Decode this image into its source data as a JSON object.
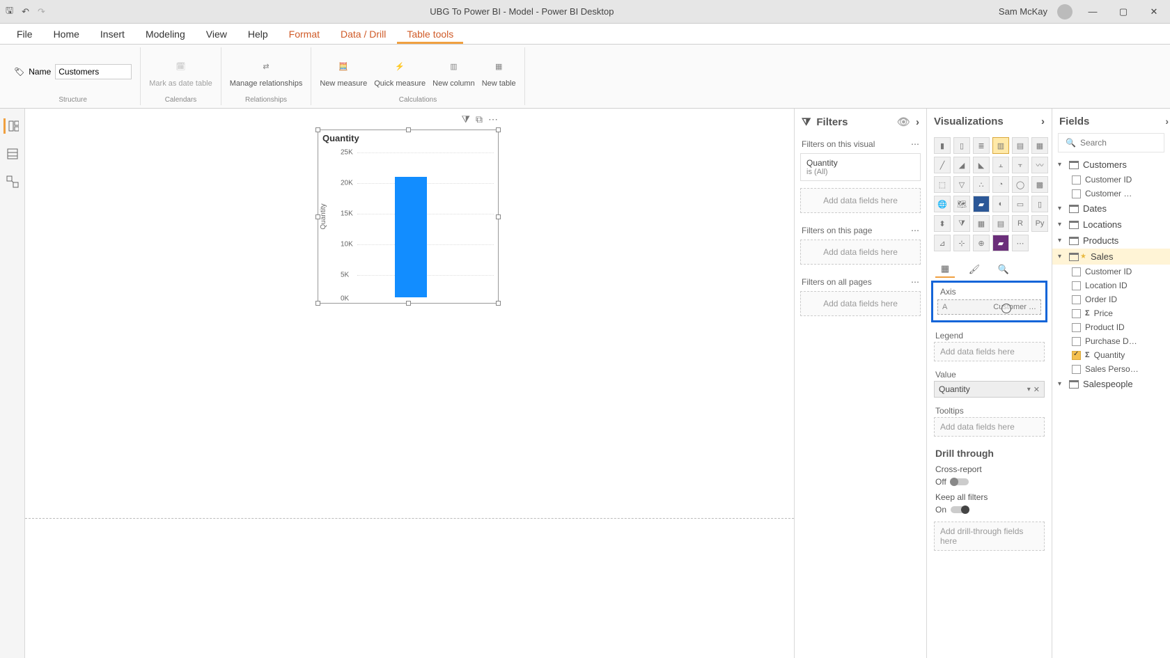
{
  "titlebar": {
    "title": "UBG To Power BI - Model - Power BI Desktop",
    "user": "Sam McKay"
  },
  "menu": {
    "tabs": [
      "File",
      "Home",
      "Insert",
      "Modeling",
      "View",
      "Help",
      "Format",
      "Data / Drill",
      "Table tools"
    ],
    "active": "Table tools"
  },
  "ribbon": {
    "name_label": "Name",
    "name_value": "Customers",
    "mark_as_date": "Mark as date table",
    "manage_rel": "Manage relationships",
    "new_measure": "New measure",
    "quick_measure": "Quick measure",
    "new_column": "New column",
    "new_table": "New table",
    "groups": {
      "structure": "Structure",
      "calendars": "Calendars",
      "relationships": "Relationships",
      "calculations": "Calculations"
    }
  },
  "visual": {
    "title": "Quantity",
    "ylabel": "Quantity",
    "ticks": [
      "25K",
      "20K",
      "15K",
      "10K",
      "5K",
      "0K"
    ]
  },
  "chart_data": {
    "type": "bar",
    "title": "Quantity",
    "ylabel": "Quantity",
    "ylim": [
      0,
      25000
    ],
    "categories": [
      ""
    ],
    "values": [
      21000
    ]
  },
  "filters": {
    "header": "Filters",
    "on_visual": "Filters on this visual",
    "q_name": "Quantity",
    "q_state": "is (All)",
    "add": "Add data fields here",
    "on_page": "Filters on this page",
    "on_all": "Filters on all pages"
  },
  "viz": {
    "header": "Visualizations",
    "axis": "Axis",
    "axis_drag": "Customer …",
    "axis_placeholder_a": "A",
    "legend": "Legend",
    "add": "Add data fields here",
    "value": "Value",
    "value_field": "Quantity",
    "tooltips": "Tooltips",
    "drill": "Drill through",
    "cross": "Cross-report",
    "off": "Off",
    "keep": "Keep all filters",
    "on": "On",
    "drill_add": "Add drill-through fields here"
  },
  "fields": {
    "header": "Fields",
    "search": "Search",
    "tables": {
      "customers": {
        "name": "Customers",
        "fields": [
          "Customer ID",
          "Customer …"
        ]
      },
      "dates": "Dates",
      "locations": "Locations",
      "products": "Products",
      "sales": {
        "name": "Sales",
        "fields": [
          "Customer ID",
          "Location ID",
          "Order ID",
          "Price",
          "Product ID",
          "Purchase D…",
          "Quantity",
          "Sales Perso…"
        ]
      },
      "salespeople": "Salespeople"
    }
  }
}
